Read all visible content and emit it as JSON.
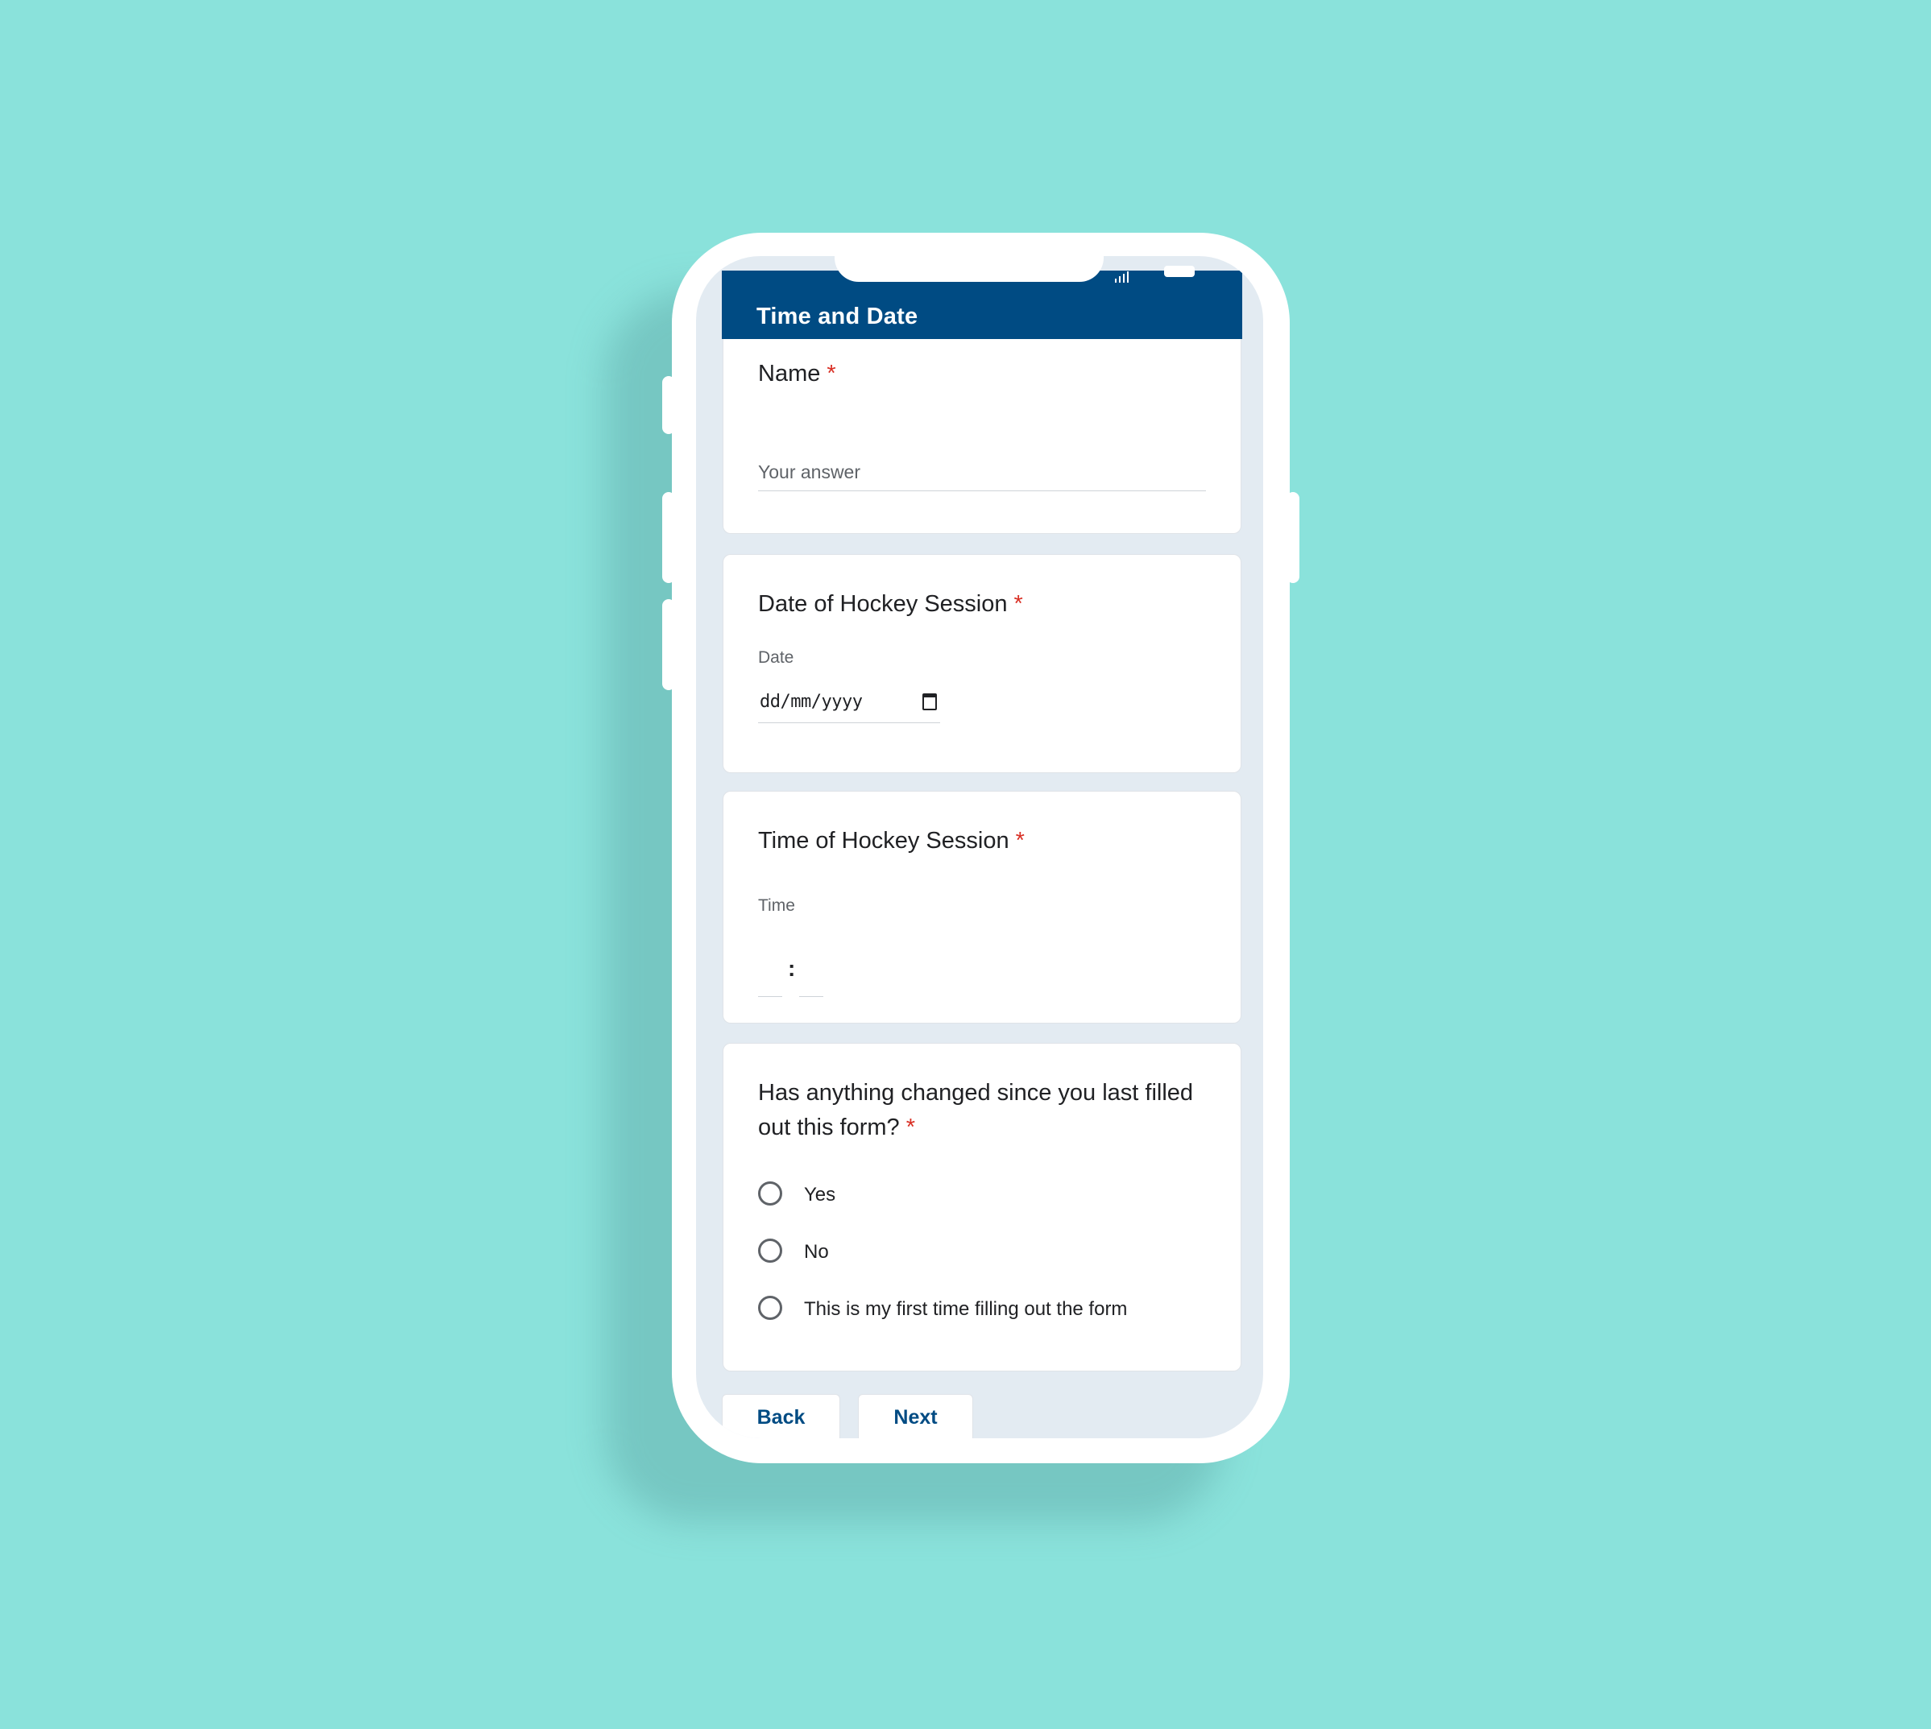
{
  "form": {
    "title": "Time and Date",
    "required_mark": "*"
  },
  "questions": {
    "name": {
      "title": "Name",
      "placeholder": "Your answer"
    },
    "date": {
      "title": "Date of Hockey Session",
      "sub_label": "Date",
      "value": "dd/mm/yyyy"
    },
    "time": {
      "title": "Time of Hockey Session",
      "sub_label": "Time",
      "separator": ":"
    },
    "changed": {
      "title": "Has anything changed since you last filled out this form?",
      "options": [
        "Yes",
        "No",
        "This is my first time filling out the form"
      ]
    }
  },
  "nav": {
    "back_label": "Back",
    "next_label": "Next"
  },
  "colors": {
    "background": "#8ae2db",
    "header": "#004b83",
    "required": "#d93025"
  },
  "icons": {
    "signal": "signal-icon",
    "battery": "battery-icon",
    "calendar": "calendar-icon",
    "radio": "radio-unchecked-icon"
  }
}
